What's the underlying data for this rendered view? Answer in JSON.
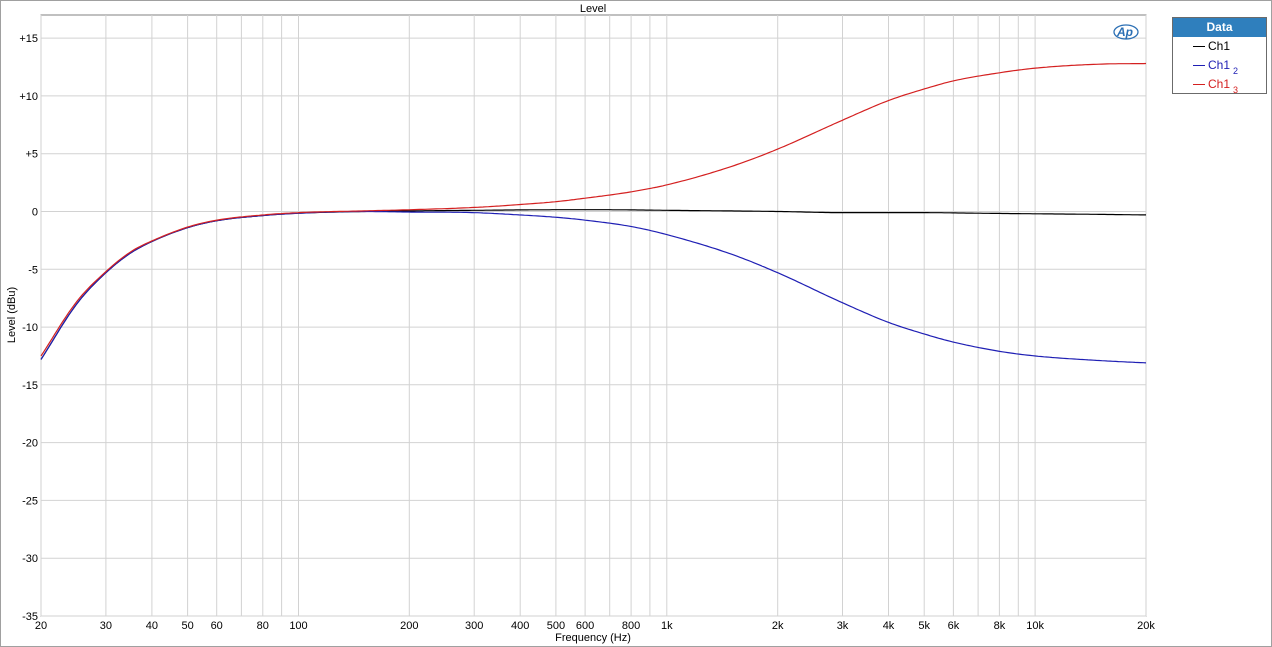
{
  "chart_data": {
    "type": "line",
    "title": "Level",
    "xlabel": "Frequency (Hz)",
    "ylabel": "Level (dBu)",
    "xscale": "log",
    "xlim": [
      20,
      20000
    ],
    "ylim": [
      -35,
      17
    ],
    "grid": true,
    "legend_position": "right",
    "legend_title": "Data",
    "x_ticks": [
      {
        "value": 20,
        "label": "20"
      },
      {
        "value": 30,
        "label": "30"
      },
      {
        "value": 40,
        "label": "40"
      },
      {
        "value": 50,
        "label": "50"
      },
      {
        "value": 60,
        "label": "60"
      },
      {
        "value": 80,
        "label": "80"
      },
      {
        "value": 100,
        "label": "100"
      },
      {
        "value": 200,
        "label": "200"
      },
      {
        "value": 300,
        "label": "300"
      },
      {
        "value": 400,
        "label": "400"
      },
      {
        "value": 500,
        "label": "500"
      },
      {
        "value": 600,
        "label": "600"
      },
      {
        "value": 800,
        "label": "800"
      },
      {
        "value": 1000,
        "label": "1k"
      },
      {
        "value": 2000,
        "label": "2k"
      },
      {
        "value": 3000,
        "label": "3k"
      },
      {
        "value": 4000,
        "label": "4k"
      },
      {
        "value": 5000,
        "label": "5k"
      },
      {
        "value": 6000,
        "label": "6k"
      },
      {
        "value": 8000,
        "label": "8k"
      },
      {
        "value": 10000,
        "label": "10k"
      },
      {
        "value": 20000,
        "label": "20k"
      }
    ],
    "x_minor_grid": [
      70,
      90,
      700,
      900,
      7000,
      9000
    ],
    "y_ticks": [
      {
        "value": 15,
        "label": "+15"
      },
      {
        "value": 10,
        "label": "+10"
      },
      {
        "value": 5,
        "label": "+5"
      },
      {
        "value": 0,
        "label": "0"
      },
      {
        "value": -5,
        "label": "-5"
      },
      {
        "value": -10,
        "label": "-10"
      },
      {
        "value": -15,
        "label": "-15"
      },
      {
        "value": -20,
        "label": "-20"
      },
      {
        "value": -25,
        "label": "-25"
      },
      {
        "value": -30,
        "label": "-30"
      },
      {
        "value": -35,
        "label": "-35"
      }
    ],
    "series": [
      {
        "name": "Ch1",
        "subscript": "",
        "color": "#000000",
        "x": [
          20,
          25,
          30,
          35,
          40,
          50,
          60,
          80,
          100,
          150,
          200,
          300,
          500,
          700,
          1000,
          2000,
          3000,
          5000,
          7000,
          10000,
          15000,
          20000
        ],
        "y": [
          -12.8,
          -8.0,
          -5.3,
          -3.6,
          -2.6,
          -1.4,
          -0.8,
          -0.35,
          -0.15,
          0.0,
          0.05,
          0.1,
          0.15,
          0.15,
          0.1,
          0.0,
          -0.1,
          -0.1,
          -0.15,
          -0.2,
          -0.25,
          -0.3
        ]
      },
      {
        "name": "Ch1",
        "subscript": "2",
        "color": "#1f1fb4",
        "x": [
          20,
          25,
          30,
          35,
          40,
          50,
          60,
          80,
          100,
          150,
          200,
          300,
          400,
          500,
          600,
          800,
          1000,
          1500,
          2000,
          3000,
          4000,
          5000,
          6000,
          8000,
          10000,
          15000,
          20000
        ],
        "y": [
          -12.8,
          -8.0,
          -5.3,
          -3.6,
          -2.6,
          -1.4,
          -0.8,
          -0.35,
          -0.15,
          0.0,
          -0.05,
          -0.1,
          -0.3,
          -0.5,
          -0.75,
          -1.3,
          -2.0,
          -3.7,
          -5.3,
          -7.9,
          -9.6,
          -10.6,
          -11.3,
          -12.1,
          -12.5,
          -12.9,
          -13.1
        ]
      },
      {
        "name": "Ch1",
        "subscript": "3",
        "color": "#d42020",
        "x": [
          20,
          25,
          30,
          35,
          40,
          50,
          60,
          80,
          100,
          150,
          200,
          300,
          400,
          500,
          600,
          800,
          1000,
          1500,
          2000,
          3000,
          4000,
          5000,
          6000,
          8000,
          10000,
          15000,
          20000
        ],
        "y": [
          -12.5,
          -7.8,
          -5.2,
          -3.5,
          -2.55,
          -1.35,
          -0.75,
          -0.3,
          -0.1,
          0.05,
          0.15,
          0.35,
          0.6,
          0.85,
          1.15,
          1.7,
          2.3,
          3.9,
          5.4,
          7.9,
          9.6,
          10.6,
          11.3,
          12.0,
          12.4,
          12.75,
          12.8
        ]
      }
    ]
  },
  "logo": {
    "text": "Ap",
    "color": "#2b6fb4"
  }
}
